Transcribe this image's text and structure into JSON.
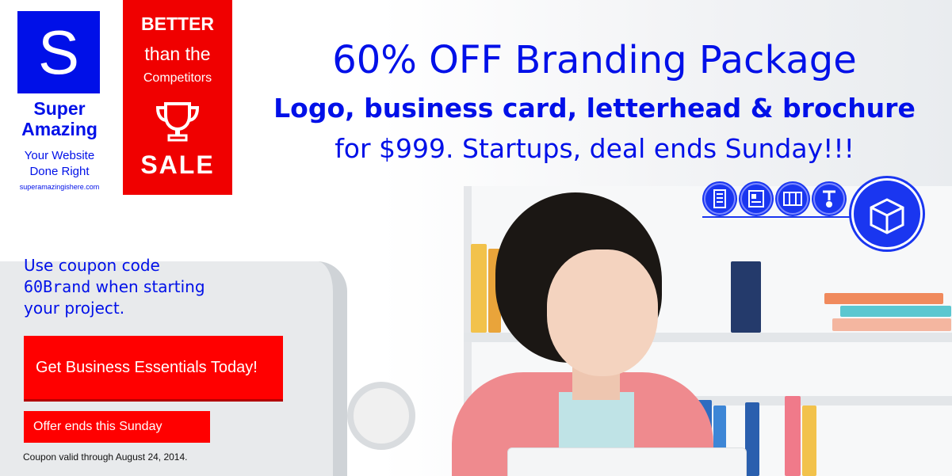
{
  "logo": {
    "letter": "S",
    "name_line1": "Super",
    "name_line2": "Amazing",
    "tagline_line1": "Your Website",
    "tagline_line2": "Done Right",
    "url": "superamazingishere.com"
  },
  "badge": {
    "line1": "BETTER",
    "line2": "than the",
    "line3": "Competitors",
    "icon": "trophy-icon",
    "sale": "SALE"
  },
  "headline": "60% OFF Branding Package",
  "subheadline": "Logo, business card, letterhead & brochure",
  "subheadline2": "for $999. Startups, deal ends Sunday!!!",
  "package_icons": [
    "letterhead-icon",
    "business-card-icon",
    "brochure-icon",
    "logo-stamp-icon",
    "package-box-icon"
  ],
  "coupon": {
    "line1": "Use coupon code",
    "code": "60Brand",
    "line2_rest": " when starting",
    "line3": "your project."
  },
  "cta_button": "Get Business Essentials Today!",
  "offer_button": "Offer ends this Sunday",
  "fine_print": "Coupon valid through August 24, 2014.",
  "colors": {
    "brand_blue": "#0010e8",
    "accent_red": "#ff0000",
    "icon_blue": "#1a36f0"
  }
}
